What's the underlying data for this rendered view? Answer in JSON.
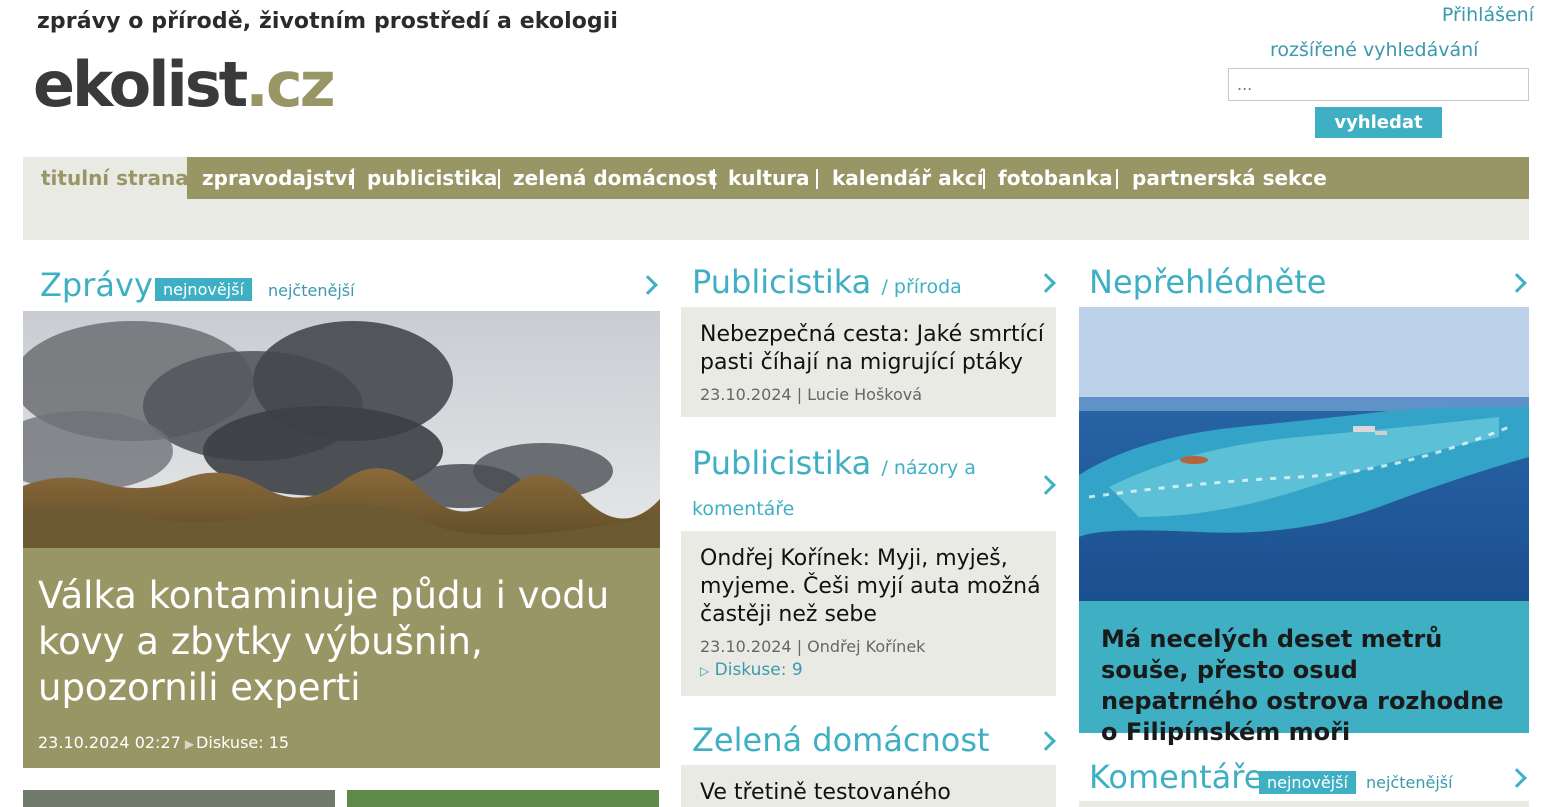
{
  "header": {
    "tagline": "zprávy o přírodě, životním prostředí a ekologii",
    "logo_main": "ekolist",
    "logo_tld": ".cz",
    "login_label": "Přihlášení",
    "advanced_search_label": "rozšířené vyhledávání",
    "search_placeholder": "...",
    "search_button": "vyhledat"
  },
  "nav": {
    "items": [
      {
        "label": "titulní strana",
        "active": true
      },
      {
        "label": "zpravodajství"
      },
      {
        "label": "publicistika"
      },
      {
        "label": "zelená domácnost"
      },
      {
        "label": "kultura"
      },
      {
        "label": "kalendář akcí"
      },
      {
        "label": "fotobanka"
      },
      {
        "label": "partnerská sekce"
      }
    ]
  },
  "news": {
    "title": "Zprávy",
    "tab_newest": "nejnovější",
    "tab_most_read": "nejčtenější",
    "hero": {
      "title": "Válka kontaminuje půdu i vodu kovy a zbytky výbušnin, upozornili experti",
      "datetime": "23.10.2024 02:27",
      "discussion": "Diskuse: 15"
    }
  },
  "publicistika_priroda": {
    "title": "Publicistika",
    "subtitle": "/ příroda",
    "article": {
      "title": "Nebezpečná cesta: Jaké smrtící pasti číhají na migrující ptáky",
      "date": "23.10.2024",
      "author": "Lucie Hošková"
    }
  },
  "publicistika_nazory": {
    "title": "Publicistika",
    "subtitle_line1": "/ názory a",
    "subtitle_line2": "komentáře",
    "article": {
      "title": "Ondřej Kořínek: Myji, myješ, myjeme. Češi myjí auta možná častěji než sebe",
      "date": "23.10.2024",
      "author": "Ondřej Kořínek",
      "discussion": "Diskuse: 9"
    }
  },
  "zelena_domacnost": {
    "title": "Zelená domácnost",
    "article": {
      "title": "Ve třetině testovaného"
    }
  },
  "neprehlednete": {
    "title": "Nepřehlédněte",
    "article": {
      "title": "Má necelých deset metrů souše, přesto osud nepatrného ostrova rozhodne o Filipínském moři"
    }
  },
  "komentare": {
    "title": "Komentáře",
    "tab_newest": "nejnovější",
    "tab_most_read": "nejčtenější"
  },
  "colors": {
    "accent": "#3fb0c4",
    "olive": "#999666",
    "light_bg": "#eaeae5"
  }
}
